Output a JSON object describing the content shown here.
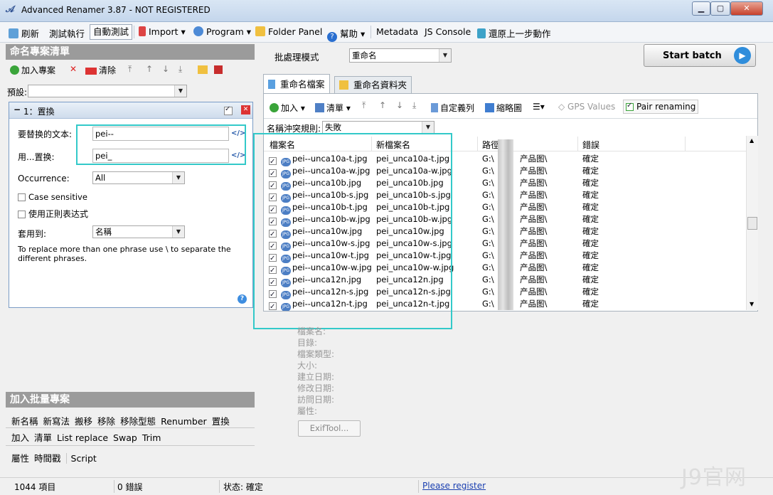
{
  "window": {
    "title": "Advanced Renamer 3.87 - NOT REGISTERED",
    "btn_min": "▁",
    "btn_max": "▢",
    "btn_close": "✕"
  },
  "toolbar": {
    "refresh": "刷新",
    "test_run": "測試執行",
    "auto_test": "自動測試",
    "import": "Import ▾",
    "program": "Program ▾",
    "folder_panel": "Folder Panel",
    "help": "幫助 ▾",
    "metadata": "Metadata",
    "js_console": "JS Console",
    "undo": "還原上一步動作"
  },
  "left": {
    "methods_header": "命名專案清單",
    "add_method": "加入專案",
    "clear": "清除",
    "preset_label": "預設:",
    "method_title": "1：置換",
    "replace_label": "要替换的文本:",
    "replace_value": "pei--",
    "with_label": "用...置换:",
    "with_value": "pei_",
    "code_glyph": "</>",
    "occurrence_label": "Occurrence:",
    "occurrence_value": "All",
    "case_sensitive": "Case sensitive",
    "regex": "使用正則表达式",
    "apply_to_label": "套用到:",
    "apply_to_value": "名稱",
    "hint": "To replace more than one phrase use \\ to separate the different phrases.",
    "help_glyph": "?",
    "batch_header": "加入批量專案",
    "batch_row1": [
      "新名稱",
      "新寫法",
      "搬移",
      "移除",
      "移除型態",
      "Renumber",
      "置換"
    ],
    "batch_row2": [
      "加入",
      "清單",
      "List replace",
      "Swap",
      "Trim"
    ],
    "batch_row3": [
      "屬性",
      "時間戳",
      "Script"
    ]
  },
  "right": {
    "batch_mode_label": "批處理模式",
    "batch_mode_value": "重命名",
    "start_batch": "Start batch",
    "tab_files": "重命名檔案",
    "tab_folders": "重命名資料夾",
    "add": "加入",
    "clear_list": "清單",
    "custom_columns": "自定義列",
    "thumbnails": "縮略圖",
    "gps_values": "GPS Values",
    "pair_renaming": "Pair renaming",
    "conflict_label": "名稱沖突規則:",
    "conflict_value": "失敗",
    "columns": [
      "檔案名",
      "新檔案名",
      "路徑",
      "錯誤"
    ],
    "rows": [
      {
        "name": "pei--unca10a-t.jpg",
        "new": "pei_unca10a-t.jpg",
        "path": "G:\\",
        "path_tail": "产品图\\",
        "status": "確定"
      },
      {
        "name": "pei--unca10a-w.jpg",
        "new": "pei_unca10a-w.jpg",
        "path": "G:\\",
        "path_tail": "产品图\\",
        "status": "確定"
      },
      {
        "name": "pei--unca10b.jpg",
        "new": "pei_unca10b.jpg",
        "path": "G:\\",
        "path_tail": "产品图\\",
        "status": "確定"
      },
      {
        "name": "pei--unca10b-s.jpg",
        "new": "pei_unca10b-s.jpg",
        "path": "G:\\",
        "path_tail": "产品图\\",
        "status": "確定"
      },
      {
        "name": "pei--unca10b-t.jpg",
        "new": "pei_unca10b-t.jpg",
        "path": "G:\\",
        "path_tail": "产品图\\",
        "status": "確定"
      },
      {
        "name": "pei--unca10b-w.jpg",
        "new": "pei_unca10b-w.jpg",
        "path": "G:\\",
        "path_tail": "产品图\\",
        "status": "確定"
      },
      {
        "name": "pei--unca10w.jpg",
        "new": "pei_unca10w.jpg",
        "path": "G:\\",
        "path_tail": "产品图\\",
        "status": "確定"
      },
      {
        "name": "pei--unca10w-s.jpg",
        "new": "pei_unca10w-s.jpg",
        "path": "G:\\",
        "path_tail": "产品图\\",
        "status": "確定"
      },
      {
        "name": "pei--unca10w-t.jpg",
        "new": "pei_unca10w-t.jpg",
        "path": "G:\\",
        "path_tail": "产品图\\",
        "status": "確定"
      },
      {
        "name": "pei--unca10w-w.jpg",
        "new": "pei_unca10w-w.jpg",
        "path": "G:\\",
        "path_tail": "产品图\\",
        "status": "確定"
      },
      {
        "name": "pei--unca12n.jpg",
        "new": "pei_unca12n.jpg",
        "path": "G:\\",
        "path_tail": "产品图\\",
        "status": "確定"
      },
      {
        "name": "pei--unca12n-s.jpg",
        "new": "pei_unca12n-s.jpg",
        "path": "G:\\",
        "path_tail": "产品图\\",
        "status": "確定"
      },
      {
        "name": "pei--unca12n-t.jpg",
        "new": "pei_unca12n-t.jpg",
        "path": "G:\\",
        "path_tail": "产品图\\",
        "status": "確定"
      }
    ],
    "jpg_badge": "JPG",
    "props": [
      "檔案名:",
      "目錄:",
      "檔案類型:",
      "大小:",
      "建立日期:",
      "修改日期:",
      "訪問日期:",
      "屬性:"
    ],
    "exiftool": "ExifTool..."
  },
  "status": {
    "items": "1044 項目",
    "errors": "0 錯誤",
    "state": "状态: 確定",
    "register": "Please register"
  },
  "watermark": "J9官网"
}
